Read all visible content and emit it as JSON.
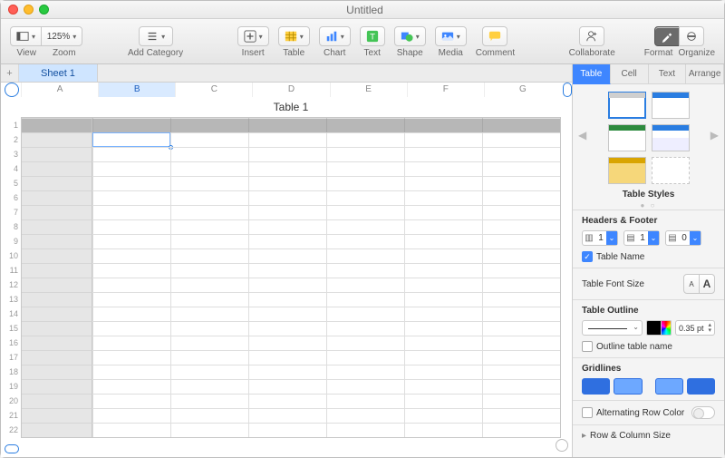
{
  "window": {
    "title": "Untitled"
  },
  "toolbar": {
    "view_label": "View",
    "zoom_value": "125%",
    "zoom_label": "Zoom",
    "add_category_label": "Add Category",
    "insert_label": "Insert",
    "table_label": "Table",
    "chart_label": "Chart",
    "text_label": "Text",
    "shape_label": "Shape",
    "media_label": "Media",
    "comment_label": "Comment",
    "collaborate_label": "Collaborate",
    "format_label": "Format",
    "organize_label": "Organize"
  },
  "sheets": {
    "tab1": "Sheet 1"
  },
  "columns": [
    "A",
    "B",
    "C",
    "D",
    "E",
    "F",
    "G"
  ],
  "rows": [
    "1",
    "2",
    "3",
    "4",
    "5",
    "6",
    "7",
    "8",
    "9",
    "10",
    "11",
    "12",
    "13",
    "14",
    "15",
    "16",
    "17",
    "18",
    "19",
    "20",
    "21",
    "22"
  ],
  "table": {
    "title": "Table 1",
    "selected_col_index": 1,
    "selected_row_index": 1
  },
  "inspector": {
    "tabs": {
      "table": "Table",
      "cell": "Cell",
      "text": "Text",
      "arrange": "Arrange"
    },
    "table_styles_label": "Table Styles",
    "headers_footer": {
      "title": "Headers & Footer",
      "header_cols": "1",
      "header_rows": "1",
      "footer_rows": "0",
      "table_name_check": "Table Name"
    },
    "font_size_label": "Table Font Size",
    "outline": {
      "title": "Table Outline",
      "pt_value": "0.35 pt",
      "outline_name_check": "Outline table name"
    },
    "gridlines_label": "Gridlines",
    "alt_row_label": "Alternating Row Color",
    "row_col_size_label": "Row & Column Size"
  }
}
